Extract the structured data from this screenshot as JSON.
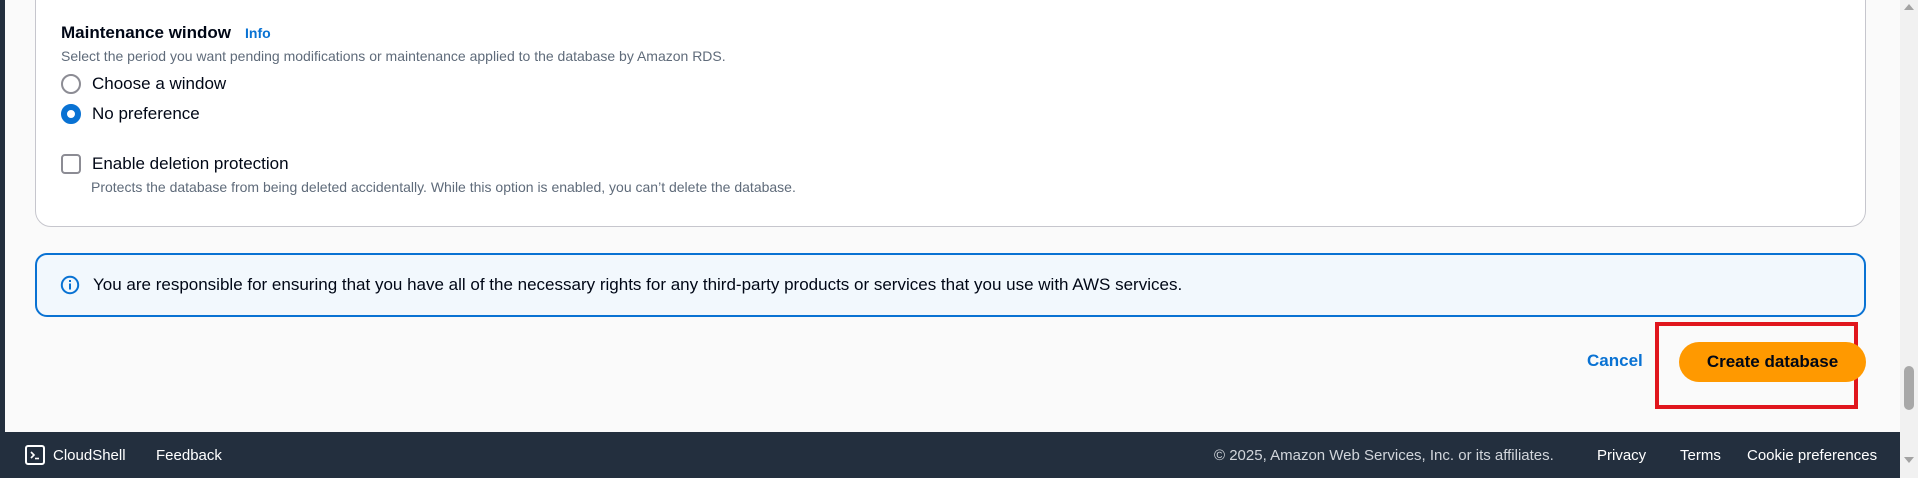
{
  "maintenance": {
    "title": "Maintenance window",
    "info_label": "Info",
    "description": "Select the period you want pending modifications or maintenance applied to the database by Amazon RDS.",
    "options": [
      {
        "label": "Choose a window",
        "selected": false
      },
      {
        "label": "No preference",
        "selected": true
      }
    ]
  },
  "deletion_protection": {
    "label": "Enable deletion protection",
    "checked": false,
    "description": "Protects the database from being deleted accidentally. While this option is enabled, you can’t delete the database."
  },
  "alert": {
    "icon": "info-circle-icon",
    "text": "You are responsible for ensuring that you have all of the necessary rights for any third-party products or services that you use with AWS services."
  },
  "actions": {
    "cancel_label": "Cancel",
    "create_label": "Create database"
  },
  "footer": {
    "cloudshell_label": "CloudShell",
    "feedback_label": "Feedback",
    "copyright": "© 2025, Amazon Web Services, Inc. or its affiliates.",
    "privacy_label": "Privacy",
    "terms_label": "Terms",
    "cookie_label": "Cookie preferences"
  },
  "colors": {
    "accent": "#0972d3",
    "primary_button": "#ff9900",
    "highlight": "#e0161d",
    "footer_bg": "#232f3e"
  }
}
